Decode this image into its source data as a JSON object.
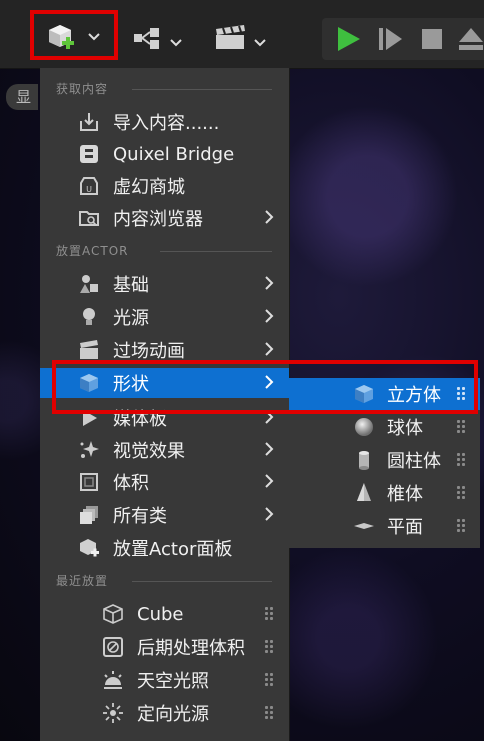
{
  "toolbar": {
    "add_content_icon": "cube-plus-icon",
    "blueprint_icon": "node-graph-icon",
    "cinematics_icon": "clapperboard-icon",
    "play_icon": "play-icon",
    "step_icon": "skip-icon",
    "stop_icon": "stop-icon",
    "eject_icon": "eject-icon",
    "left_pill_label": "显"
  },
  "menu": {
    "section_get_content": "获取内容",
    "section_place_actor": "放置ACTOR",
    "section_recent": "最近放置",
    "get_content_items": [
      {
        "label": "导入内容......",
        "icon": "import-icon"
      },
      {
        "label": "Quixel Bridge",
        "icon": "bridge-icon"
      },
      {
        "label": "虚幻商城",
        "icon": "marketplace-icon"
      },
      {
        "label": "内容浏览器",
        "icon": "content-browser-icon"
      }
    ],
    "place_actor_items": [
      {
        "label": "基础",
        "icon": "basic-icon"
      },
      {
        "label": "光源",
        "icon": "light-bulb-icon"
      },
      {
        "label": "过场动画",
        "icon": "clapperboard-icon"
      },
      {
        "label": "形状",
        "icon": "cube-icon"
      },
      {
        "label": "媒体板",
        "icon": "media-icon"
      },
      {
        "label": "视觉效果",
        "icon": "sparkle-icon"
      },
      {
        "label": "体积",
        "icon": "volume-icon"
      },
      {
        "label": "所有类",
        "icon": "classes-icon"
      },
      {
        "label": "放置Actor面板",
        "icon": "place-actor-icon"
      }
    ],
    "recent_items": [
      {
        "label": "Cube",
        "icon": "cube-outline-icon"
      },
      {
        "label": "后期处理体积",
        "icon": "post-process-icon"
      },
      {
        "label": "天空光照",
        "icon": "sky-light-icon"
      },
      {
        "label": "定向光源",
        "icon": "directional-light-icon"
      }
    ]
  },
  "submenu": {
    "items": [
      {
        "label": "立方体",
        "icon": "cube-icon"
      },
      {
        "label": "球体",
        "icon": "sphere-icon"
      },
      {
        "label": "圆柱体",
        "icon": "cylinder-icon"
      },
      {
        "label": "椎体",
        "icon": "cone-icon"
      },
      {
        "label": "平面",
        "icon": "plane-icon"
      }
    ]
  },
  "colors": {
    "highlight": "#0e70d1",
    "annotation_red": "#e00000",
    "play_green": "#3fbf3f"
  }
}
